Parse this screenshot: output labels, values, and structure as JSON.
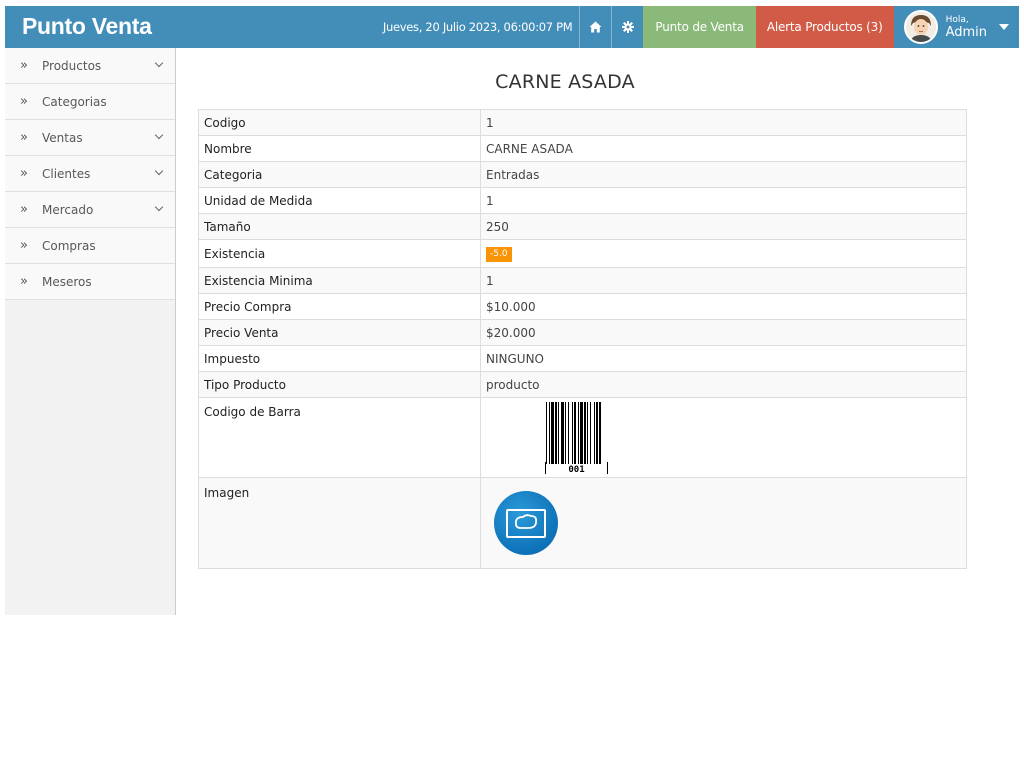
{
  "app": {
    "brand": "Punto Venta"
  },
  "header": {
    "datetime": "Jueves, 20 Julio 2023, 06:00:07 PM",
    "home_icon": "home-icon",
    "settings_icon": "gear-icon",
    "pos_button": "Punto de Venta",
    "alert_button": "Alerta Productos (3)",
    "greeting": "Hola,",
    "user": "Admin"
  },
  "colors": {
    "topbar": "#438eb9",
    "pos_button": "#8bb97a",
    "alert_button": "#d15b47",
    "badge": "#f89406"
  },
  "sidebar": {
    "items": [
      {
        "label": "Productos",
        "has_children": true
      },
      {
        "label": "Categorias",
        "has_children": false
      },
      {
        "label": "Ventas",
        "has_children": true
      },
      {
        "label": "Clientes",
        "has_children": true
      },
      {
        "label": "Mercado",
        "has_children": true
      },
      {
        "label": "Compras",
        "has_children": false
      },
      {
        "label": "Meseros",
        "has_children": false
      }
    ]
  },
  "product": {
    "title": "CARNE ASADA",
    "fields": {
      "codigo": {
        "label": "Codigo",
        "value": "1"
      },
      "nombre": {
        "label": "Nombre",
        "value": "CARNE ASADA"
      },
      "categoria": {
        "label": "Categoria",
        "value": "Entradas"
      },
      "unidad": {
        "label": "Unidad de Medida",
        "value": "1"
      },
      "tamano": {
        "label": "Tamaño",
        "value": "250"
      },
      "existencia": {
        "label": "Existencia",
        "value": "-5.0"
      },
      "existencia_minima": {
        "label": "Existencia Minima",
        "value": "1"
      },
      "precio_compra": {
        "label": "Precio Compra",
        "value": "$10.000"
      },
      "precio_venta": {
        "label": "Precio Venta",
        "value": "$20.000"
      },
      "impuesto": {
        "label": "Impuesto",
        "value": "NINGUNO"
      },
      "tipo": {
        "label": "Tipo Producto",
        "value": "producto"
      },
      "barcode": {
        "label": "Codigo de Barra",
        "value": "001"
      },
      "imagen": {
        "label": "Imagen"
      }
    }
  }
}
